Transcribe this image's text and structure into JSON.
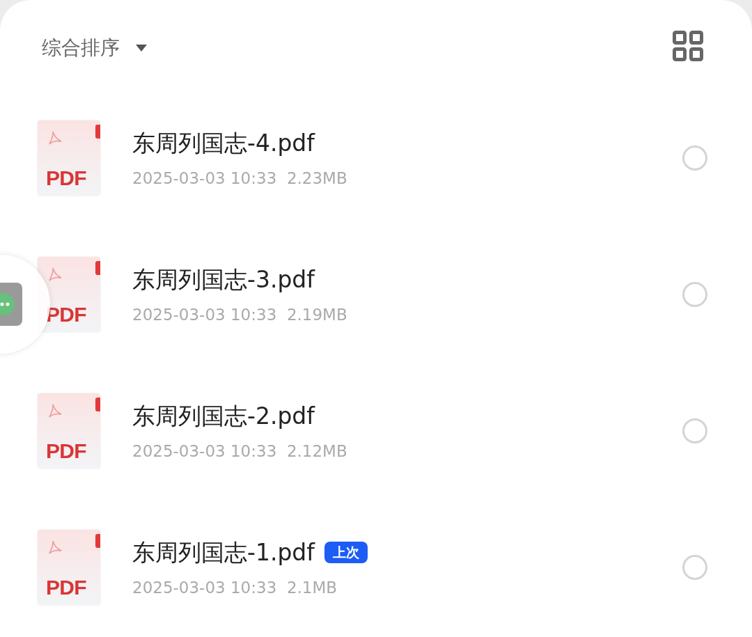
{
  "toolbar": {
    "sort_label": "综合排序"
  },
  "files": [
    {
      "name": "东周列国志-4.pdf",
      "meta": "2025-03-03 10:33  2.23MB",
      "icon_label": "PDF",
      "selected": false
    },
    {
      "name": "东周列国志-3.pdf",
      "meta": "2025-03-03 10:33  2.19MB",
      "icon_label": "PDF",
      "selected": false
    },
    {
      "name": "东周列国志-2.pdf",
      "meta": "2025-03-03 10:33  2.12MB",
      "icon_label": "PDF",
      "selected": false
    },
    {
      "name": "东周列国志-1.pdf",
      "meta": "2025-03-03 10:33  2.1MB",
      "icon_label": "PDF",
      "selected": false,
      "badge": "上次"
    }
  ]
}
